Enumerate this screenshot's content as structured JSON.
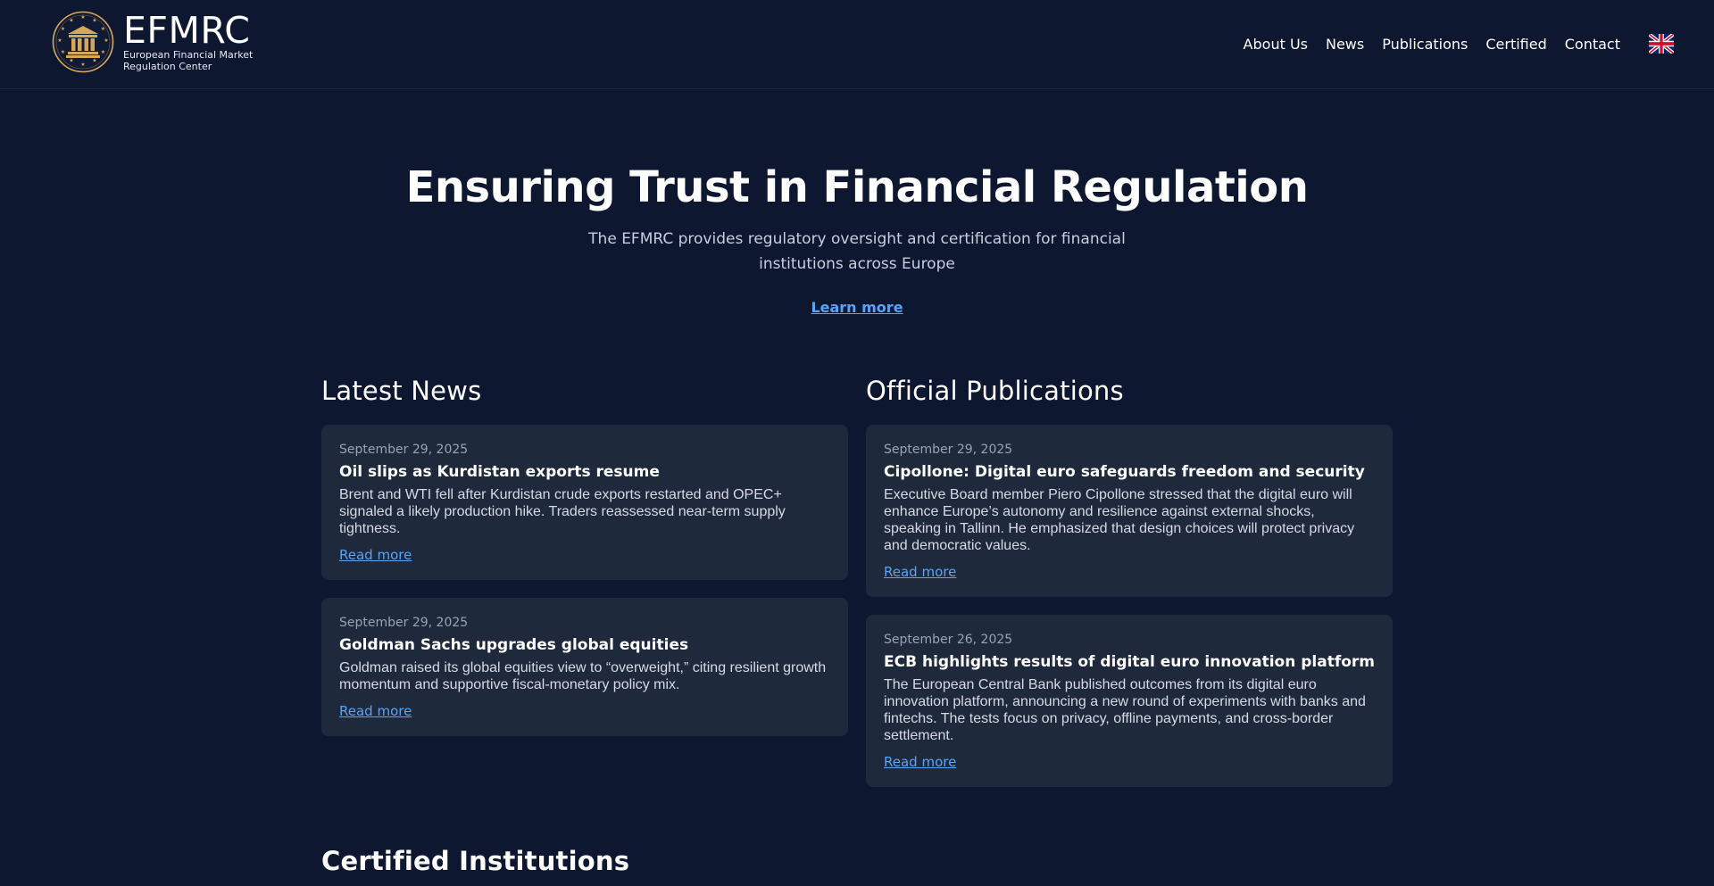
{
  "header": {
    "logo_title": "EFMRC",
    "logo_subtitle_line1": "European Financial Market",
    "logo_subtitle_line2": "Regulation Center",
    "nav": [
      "About Us",
      "News",
      "Publications",
      "Certified",
      "Contact"
    ],
    "language_icon": "uk-flag-icon"
  },
  "hero": {
    "title": "Ensuring Trust in Financial Regulation",
    "subtitle": "The EFMRC provides regulatory oversight and certification for financial institutions across Europe",
    "link": "Learn more"
  },
  "news": {
    "title": "Latest News",
    "items": [
      {
        "date": "September 29, 2025",
        "title": "Oil slips as Kurdistan exports resume",
        "text": "Brent and WTI fell after Kurdistan crude exports restarted and OPEC+ signaled a likely production hike. Traders reassessed near-term supply tightness.",
        "link": "Read more"
      },
      {
        "date": "September 29, 2025",
        "title": "Goldman Sachs upgrades global equities",
        "text": "Goldman raised its global equities view to “overweight,” citing resilient growth momentum and supportive fiscal-monetary policy mix.",
        "link": "Read more"
      }
    ]
  },
  "publications": {
    "title": "Official Publications",
    "items": [
      {
        "date": "September 29, 2025",
        "title": "Cipollone: Digital euro safeguards freedom and security",
        "text": "Executive Board member Piero Cipollone stressed that the digital euro will enhance Europe’s autonomy and resilience against external shocks, speaking in Tallinn. He emphasized that design choices will protect privacy and democratic values.",
        "link": "Read more"
      },
      {
        "date": "September 26, 2025",
        "title": "ECB highlights results of digital euro innovation platform",
        "text": "The European Central Bank published outcomes from its digital euro innovation platform, announcing a new round of experiments with banks and fintechs. The tests focus on privacy, offline payments, and cross-border settlement.",
        "link": "Read more"
      }
    ]
  },
  "certified": {
    "title": "Certified Institutions"
  },
  "colors": {
    "background": "#0e1730",
    "card": "#1e293b",
    "link": "#5ba3f5",
    "logo_gold": "#d6a75a"
  }
}
